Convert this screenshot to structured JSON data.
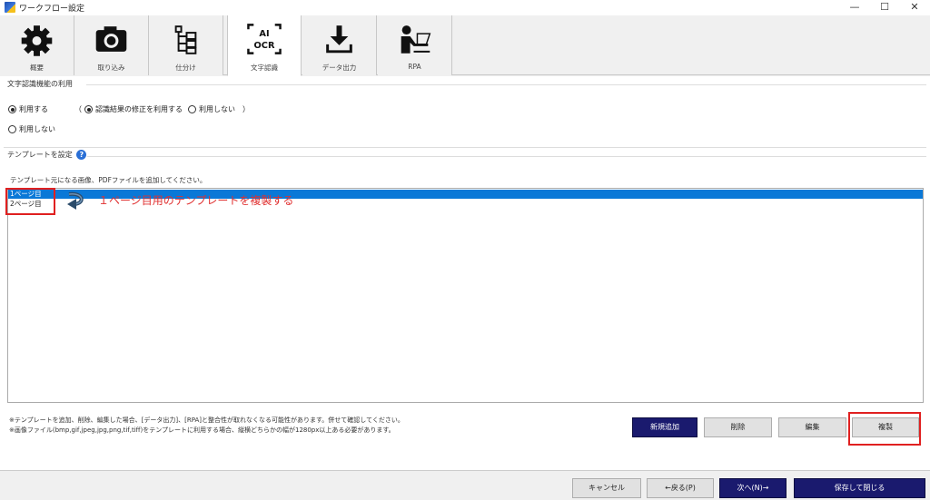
{
  "window": {
    "title": "ワークフロー設定",
    "minimize": "—",
    "maximize": "☐",
    "close": "✕"
  },
  "tabs": [
    {
      "label": "概要",
      "icon": "gear-icon"
    },
    {
      "label": "取り込み",
      "icon": "camera-icon"
    },
    {
      "label": "仕分け",
      "icon": "tree-icon"
    },
    {
      "label": "文字認識",
      "icon": "ai-ocr-icon",
      "icon_text_1": "AI",
      "icon_text_2": "OCR",
      "active": true
    },
    {
      "label": "データ出力",
      "icon": "download-icon"
    },
    {
      "label": "RPA",
      "icon": "rpa-icon"
    }
  ],
  "ocr_section": {
    "title": "文字認識機能の利用",
    "use_label": "利用する",
    "paren_open": "（",
    "correction_label": "認識結果の修正を利用する",
    "no_correction_label": "利用しない",
    "paren_close": "）",
    "not_use_label": "利用しない"
  },
  "template_section": {
    "title": "テンプレートを設定",
    "help": "?",
    "instruction": "テンプレート元になる画像、PDFファイルを追加してください。",
    "items": [
      "1ページ目",
      "2ページ目"
    ],
    "annotation": "１ページ目用のテンプレートを複製する",
    "footnote1": "※テンプレートを追加、削除、編集した場合、[データ出力]、[RPA]と整合性が取れなくなる可能性があります。併せて確認してください。",
    "footnote2": "※画像ファイル(bmp,gif,jpeg,jpg,png,tif,tiff)をテンプレートに利用する場合、縦横どちらかの幅が1280px以上ある必要があります。",
    "buttons": {
      "add": "新規追加",
      "delete": "削除",
      "edit": "編集",
      "duplicate": "複製"
    }
  },
  "footer": {
    "cancel": "キャンセル",
    "back": "←戻る(P)",
    "next": "次へ(N)→",
    "save_close": "保存して閉じる"
  },
  "colors": {
    "accent": "#1a1a6e",
    "selection": "#0a78d7",
    "highlight": "#e02020"
  }
}
